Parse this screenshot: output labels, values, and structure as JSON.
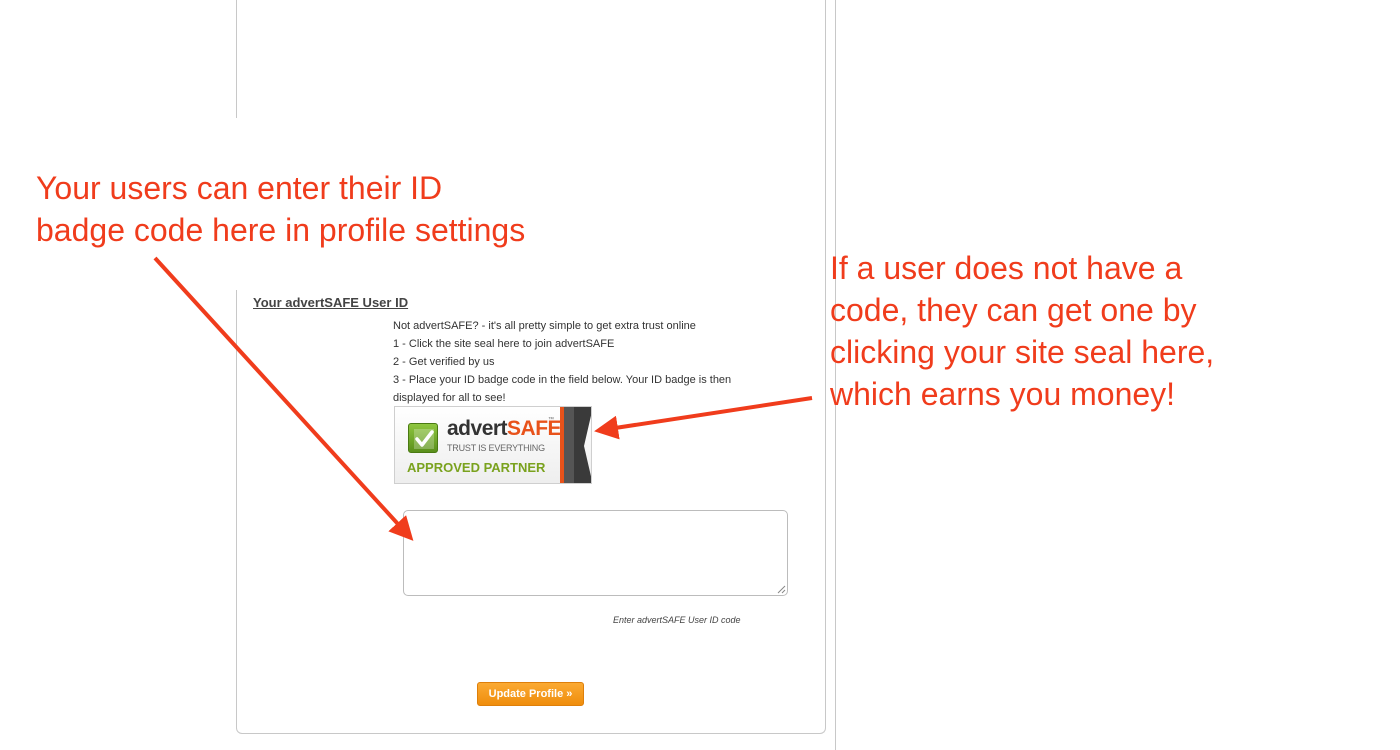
{
  "profile_section": {
    "title": "Your advertSAFE User ID",
    "instructions": [
      "Not advertSAFE? - it's all pretty simple to get extra trust online",
      "1 - Click the site seal here to join advertSAFE",
      "2 - Get verified by us",
      "3 - Place your ID badge code in the field below. Your ID badge is then",
      "displayed for all to see!"
    ],
    "seal": {
      "brand_part1": "adv",
      "brand_part2": "ert",
      "brand_part3": "SAFE",
      "trademark": "™",
      "tagline": "TRUST IS EVERYTHING",
      "partner_label": "APPROVED PARTNER",
      "icon": "checkmark-icon"
    },
    "code_input": {
      "value": "",
      "placeholder": ""
    },
    "hint": "Enter advertSAFE User ID code",
    "update_button": "Update Profile »"
  },
  "annotations": {
    "left": [
      "Your users can enter their ID",
      "badge code here in profile settings"
    ],
    "right": [
      "If a user does not have a",
      "code, they can get one by",
      "clicking your site seal here,",
      "which earns you money!"
    ]
  },
  "colors": {
    "annotation": "#f03c1c",
    "button": "#f59a1e",
    "seal_green": "#7aa21e",
    "seal_orange": "#e8521a"
  }
}
